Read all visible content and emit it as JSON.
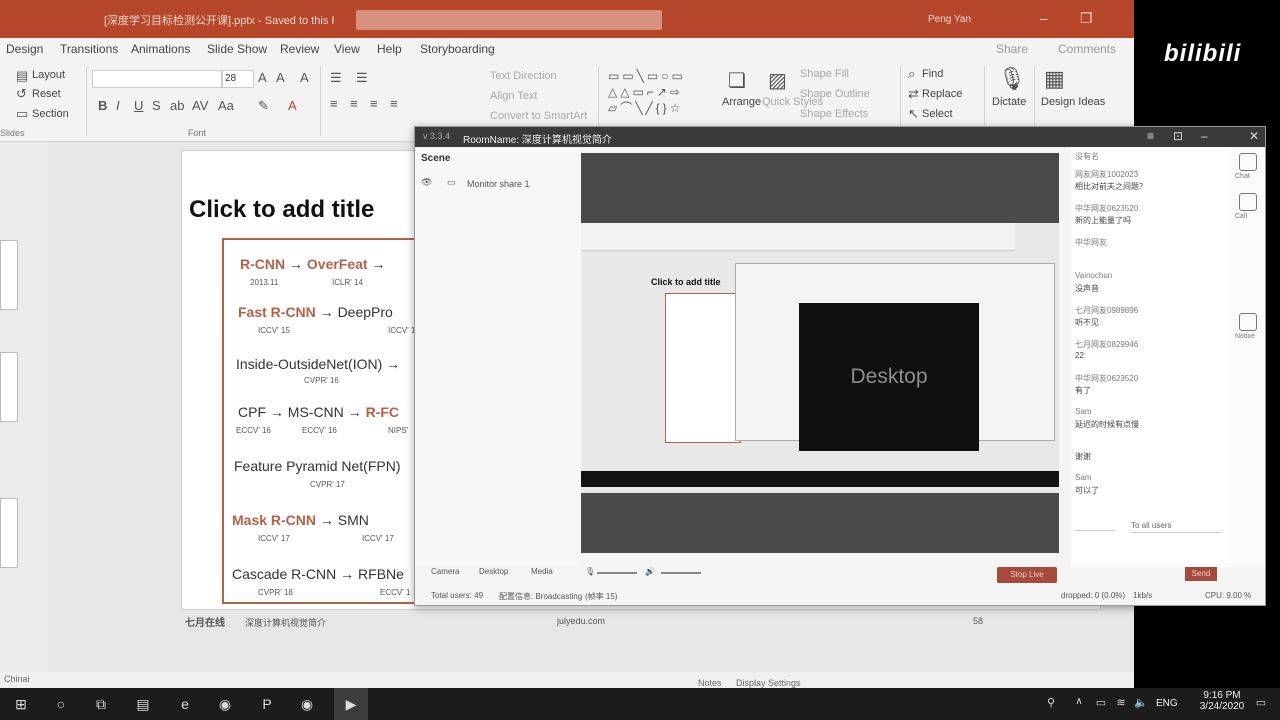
{
  "app": {
    "doc_title": "[深度学习目标检测公开课].pptx - Saved to this PC",
    "user": "Peng Yan"
  },
  "ribbon": {
    "tabs": [
      "Design",
      "Transitions",
      "Animations",
      "Slide Show",
      "Review",
      "View",
      "Help",
      "Storyboarding"
    ],
    "share": "Share",
    "comments": "Comments",
    "slides": {
      "layout": "Layout",
      "reset": "Reset",
      "section": "Section",
      "label": "Slides"
    },
    "font": {
      "size": "28",
      "label": "Font"
    },
    "paragraph": {
      "text_direction": "Text Direction",
      "align_text": "Align Text",
      "convert": "Convert to SmartArt"
    },
    "drawing": {
      "arrange": "Arrange",
      "quick_styles": "Quick Styles",
      "shape_fill": "Shape Fill",
      "shape_outline": "Shape Outline",
      "shape_effects": "Shape Effects"
    },
    "editing": {
      "find": "Find",
      "replace": "Replace",
      "select": "Select"
    },
    "voice": {
      "dictate": "Dictate"
    },
    "designer": {
      "design_ideas": "Design Ideas"
    }
  },
  "slide": {
    "title_placeholder": "Click to add title",
    "timeline": [
      {
        "name": "R-CNN",
        "next": "OverFeat",
        "venue": "2013.11",
        "venue2": "ICLR' 14"
      },
      {
        "name": "Fast R-CNN",
        "next": "DeepPro",
        "venue": "ICCV' 15",
        "venue2": "ICCV' 1"
      },
      {
        "name": "Inside-OutsideNet(ION)",
        "venue": "CVPR' 16"
      },
      {
        "name": "CPF",
        "next": "MS-CNN",
        "next2": "R-FC",
        "venue": "ECCV' 16",
        "venue2": "ECCV' 16",
        "venue3": "NIPS'"
      },
      {
        "name": "Feature Pyramid Net(FPN)",
        "venue": "CVPR' 17"
      },
      {
        "name": "Mask R-CNN",
        "next": "SMN",
        "venue": "ICCV' 17",
        "venue2": "ICCV' 17"
      },
      {
        "name": "Cascade R-CNN",
        "next": "RFBNe",
        "venue": "CVPR' 18",
        "venue2": "ECCV' 1"
      }
    ],
    "footer_brand": "七月在线",
    "footer_course": "深度计算机视觉简介",
    "footer_url": "julyedu.com",
    "footer_page": "58"
  },
  "statusbar": {
    "left": "Chinai",
    "notes": "Notes",
    "display_settings": "Display Settings"
  },
  "stream": {
    "version": "v 3.3.4",
    "room_name": "RoomName: 深度计算机视觉简介",
    "scene_label": "Scene",
    "scene_item": "Monitor share 1",
    "preview_slide_title": "Click to add title",
    "preview_desktop_label": "Desktop",
    "sources": [
      "Camera",
      "Desktop",
      "Media"
    ],
    "stream_button": "Stop Live",
    "send_button": "Send",
    "total_users": "Total users: 49",
    "broadcasting": "配置信息: Broadcasting",
    "status_mid": "(帧率 15)",
    "dropped": "dropped: 0 (0.0%)",
    "bitrate": "1kb/s",
    "cpu": "CPU: 9.00 %",
    "chat_filter": "To all users",
    "side_labels": [
      "Chat",
      "Call",
      "Notice"
    ],
    "chat": [
      {
        "user": "没有名",
        "msg": ""
      },
      {
        "user": "网友网友1002023",
        "msg": "相比对前夫之间题？"
      },
      {
        "user": "中华网友0623520",
        "msg": "新的上能量了吗"
      },
      {
        "user": "中华网友",
        "msg": ""
      },
      {
        "user": "Vainochun",
        "msg": "没声音"
      },
      {
        "user": "七月网友0989896",
        "msg": "听不见"
      },
      {
        "user": "七月网友0829946",
        "msg": "22"
      },
      {
        "user": "中华网友0623520",
        "msg": "有了"
      },
      {
        "user": "Sam",
        "msg": "延迟的时候有点慢"
      },
      {
        "user": "",
        "msg": "谢谢"
      },
      {
        "user": "Sam",
        "msg": "可以了"
      }
    ]
  },
  "taskbar": {
    "time": "9:16 PM",
    "date": "3/24/2020",
    "lang": "ENG"
  },
  "overlay": {
    "logo": "bilibili"
  }
}
